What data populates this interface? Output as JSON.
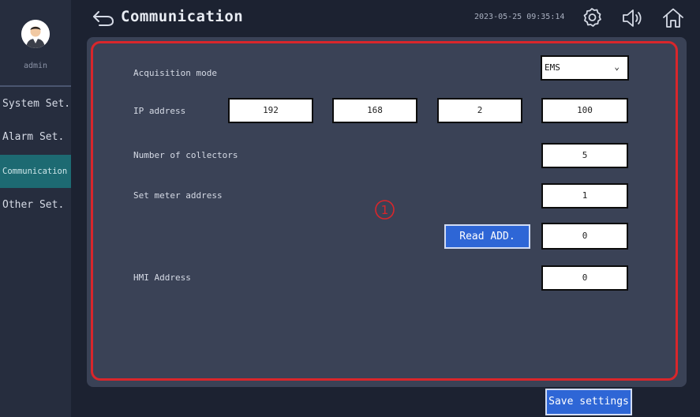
{
  "sidebar": {
    "username": "admin",
    "items": [
      {
        "label": "System Set."
      },
      {
        "label": "Alarm Set."
      },
      {
        "label": "Communication"
      },
      {
        "label": "Other Set."
      }
    ],
    "active_index": 2
  },
  "header": {
    "title": "Communication",
    "datetime": "2023-05-25 09:35:14",
    "icons": [
      "back-arrow-icon",
      "gear-icon",
      "speaker-icon",
      "home-icon"
    ]
  },
  "form": {
    "acquisition_mode": {
      "label": "Acquisition mode",
      "value": "EMS"
    },
    "ip_address": {
      "label": "IP address",
      "octets": [
        "192",
        "168",
        "2",
        "100"
      ]
    },
    "collectors": {
      "label": "Number of collectors",
      "value": "5"
    },
    "meter_address": {
      "label": "Set meter address",
      "value": "1"
    },
    "read_address": {
      "button_label": "Read ADD.",
      "value": "0"
    },
    "hmi_address": {
      "label": "HMI Address",
      "value": "0"
    }
  },
  "marker": "①",
  "footer": {
    "save_label": "Save settings"
  },
  "colors": {
    "background": "#1c2231",
    "panel": "#3a4256",
    "highlight_border": "#d9262b",
    "active_nav": "#1d6a72",
    "button": "#2e66d6"
  }
}
